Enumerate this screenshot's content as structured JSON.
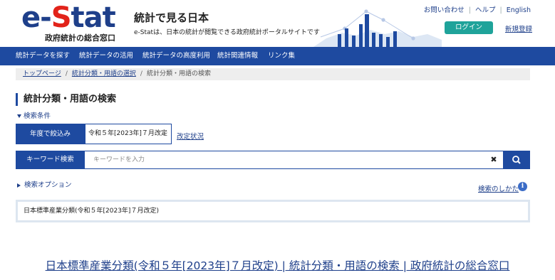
{
  "header": {
    "logo_prefix": "e-",
    "logo_s": "S",
    "logo_rest": "tat",
    "logo_sub": "政府統計の総合窓口",
    "site_title": "統計で見る日本",
    "site_desc": "e-Statは、日本の統計が閲覧できる政府統計ポータルサイトです",
    "links": [
      "お問い合わせ",
      "ヘルプ",
      "English"
    ],
    "login_label": "ログイン",
    "register_label": "新規登録"
  },
  "nav": {
    "items": [
      "統計データを探す",
      "統計データの活用",
      "統計データの高度利用",
      "統計関連情報",
      "リンク集"
    ]
  },
  "breadcrumb": {
    "items": [
      "トップページ",
      "統計分類・用語の選択"
    ],
    "current": "統計分類・用語の検索"
  },
  "page": {
    "heading": "統計分類・用語の検索",
    "condition_toggle": "検索条件",
    "year_label": "年度で絞込み",
    "year_selected": "令和５年[2023年]７月改定",
    "revision_link": "改定状況",
    "keyword_label": "キーワード検索",
    "keyword_placeholder": "キーワードを入力",
    "keyword_value": "",
    "clear_glyph": "✖",
    "option_toggle": "検索オプション",
    "howto_link": "検索のしかた",
    "info_glyph": "i",
    "result_item": "日本標準産業分類(令和５年[2023年]７月改定)"
  },
  "window": {
    "tab_title": "日本標準産業分類(令和５年[2023年]７月改定) | 統計分類・用語の検索 | 政府統計の総合窓口"
  },
  "colors": {
    "brand_blue": "#1e4aa0",
    "logo_red": "#e2231a",
    "login_green": "#1fa39a",
    "link_blue": "#1e3f8a"
  }
}
